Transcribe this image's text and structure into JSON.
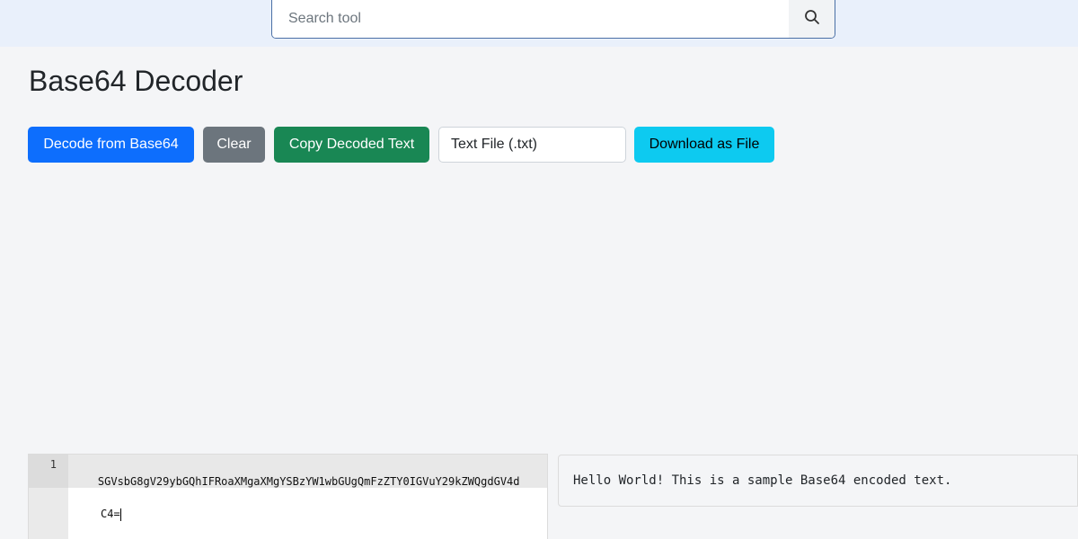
{
  "search": {
    "placeholder": "Search tool",
    "icon": "search-icon"
  },
  "page": {
    "title": "Base64 Decoder"
  },
  "toolbar": {
    "decode_label": "Decode from Base64",
    "clear_label": "Clear",
    "copy_label": "Copy Decoded Text",
    "format_selected": "Text File (.txt)",
    "download_label": "Download as File"
  },
  "editor": {
    "line_number": "1",
    "line_text": "SGVsbG8gV29ybGQhIFRoaXMgaXMgYSBzYW1wbGUgQmFzZTY0IGVuY29kZWQgdGV4d",
    "line_wrap": "C4="
  },
  "output": {
    "text": "Hello World! This is a sample Base64 encoded text."
  },
  "colors": {
    "primary": "#0d6efd",
    "secondary": "#6c757d",
    "success": "#198754",
    "info": "#0dcaf0"
  }
}
